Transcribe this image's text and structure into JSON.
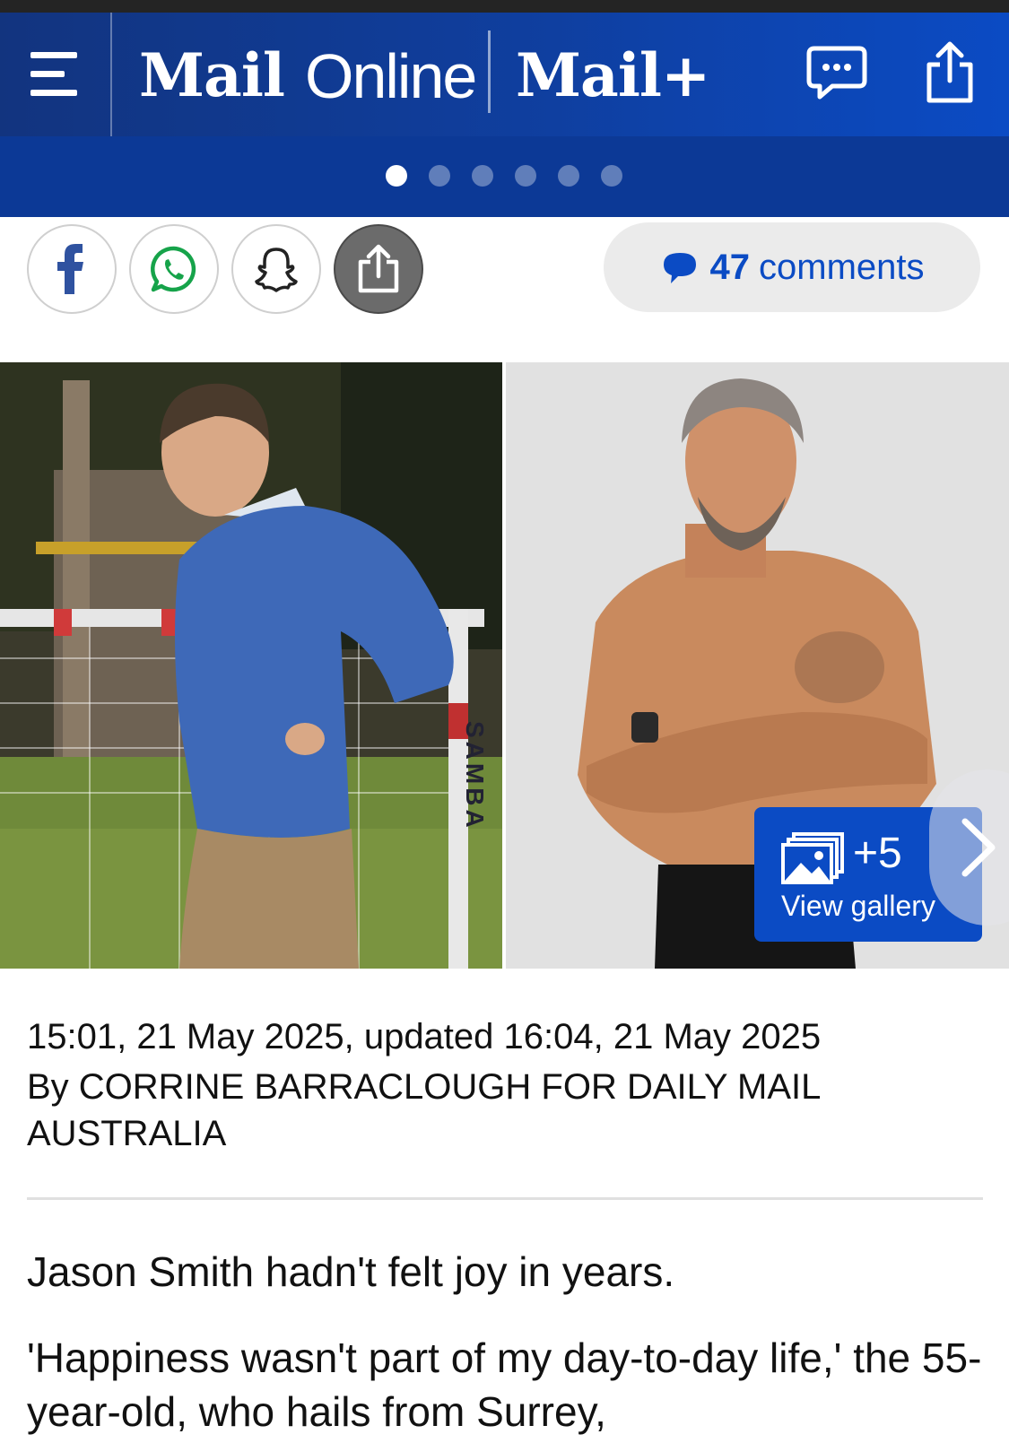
{
  "header": {
    "logo_mail": "Mail",
    "logo_online": "Online",
    "logo_plus": "Mail+",
    "menu_icon": "hamburger-menu-icon",
    "comment_icon": "speech-bubble-icon",
    "share_icon": "share-icon"
  },
  "carousel": {
    "dot_count": 6,
    "active_index": 0
  },
  "share": {
    "buttons": [
      "facebook-icon",
      "whatsapp-icon",
      "snapchat-icon",
      "share-icon"
    ],
    "comments_count": "47",
    "comments_label": "comments"
  },
  "gallery": {
    "count": "+5",
    "label": "View gallery",
    "goal_post_text": "SAMBA"
  },
  "article": {
    "timestamp": "15:01, 21 May 2025, updated 16:04, 21 May 2025",
    "byline": "By CORRINE BARRACLOUGH FOR DAILY MAIL AUSTRALIA",
    "paragraphs": [
      "Jason Smith hadn't felt joy in years.",
      "'Happiness wasn't part of my day-to-day life,' the 55-year-old, who hails from Surrey,"
    ]
  },
  "colors": {
    "brand_blue": "#0b4bc4",
    "header_dark": "#12347f",
    "pill_bg": "#ebebeb"
  }
}
